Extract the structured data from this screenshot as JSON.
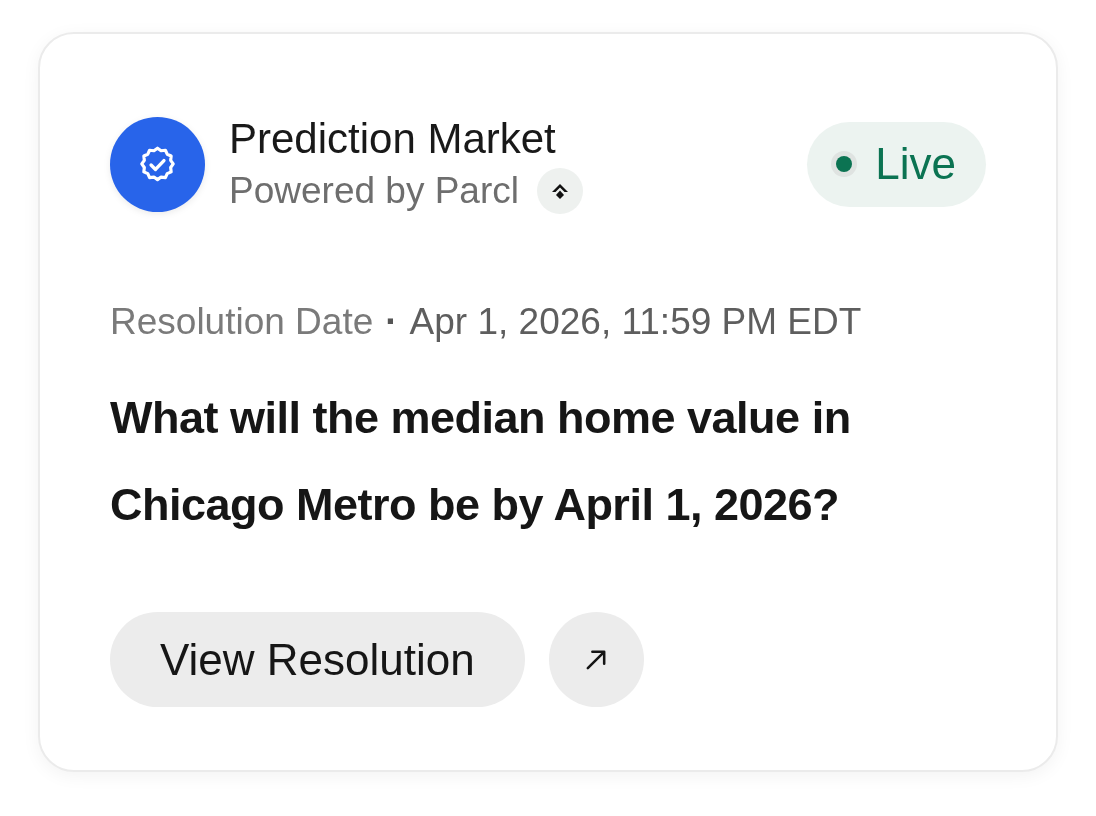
{
  "header": {
    "title": "Prediction Market",
    "subtitle": "Powered by Parcl"
  },
  "status": {
    "label": "Live"
  },
  "resolution": {
    "label": "Resolution Date",
    "separator": "·",
    "date": "Apr 1, 2026, 11:59 PM EDT"
  },
  "question": "What will the median home value in Chicago Metro be by April 1, 2026?",
  "actions": {
    "primary": "View Resolution"
  }
}
